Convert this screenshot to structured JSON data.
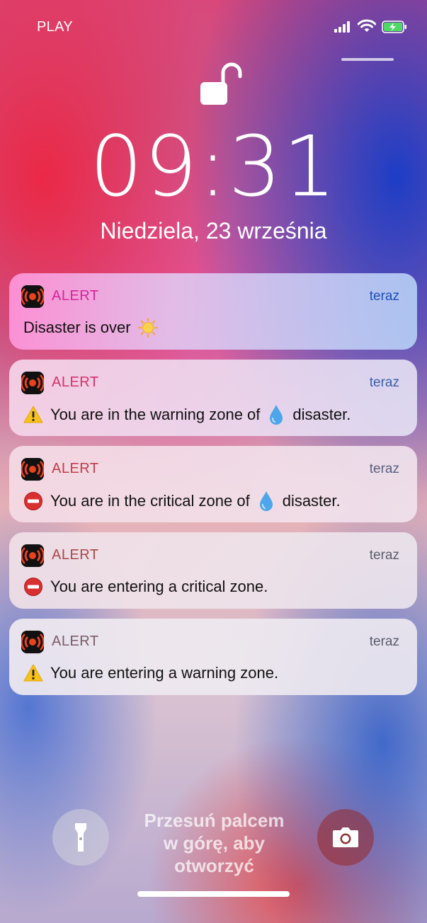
{
  "status_bar": {
    "carrier": "PLAY"
  },
  "lock_screen": {
    "time": "09:31",
    "date": "Niedziela, 23 września",
    "swipe_hint_line1": "Przesuń palcem",
    "swipe_hint_line2": "w górę, aby",
    "swipe_hint_line3": "otworzyć"
  },
  "notifications": [
    {
      "app": "ALERT",
      "time": "teraz",
      "lead_icon": "",
      "text": "Disaster is over",
      "inline_icon": "sun-icon",
      "suffix": ""
    },
    {
      "app": "ALERT",
      "time": "teraz",
      "lead_icon": "warning-icon",
      "text": "You are in the warning zone of",
      "inline_icon": "droplet-icon",
      "suffix": "disaster."
    },
    {
      "app": "ALERT",
      "time": "teraz",
      "lead_icon": "no-entry-icon",
      "text": "You are in the critical zone of",
      "inline_icon": "droplet-icon",
      "suffix": "disaster."
    },
    {
      "app": "ALERT",
      "time": "teraz",
      "lead_icon": "no-entry-icon",
      "text": "You are entering a critical zone.",
      "inline_icon": "",
      "suffix": ""
    },
    {
      "app": "ALERT",
      "time": "teraz",
      "lead_icon": "warning-icon",
      "text": "You are entering a warning zone.",
      "inline_icon": "",
      "suffix": ""
    }
  ],
  "colors": {
    "app_icon_bg": "#111111",
    "app_icon_accent": "#e8431e",
    "battery_fill": "#4cd964"
  }
}
